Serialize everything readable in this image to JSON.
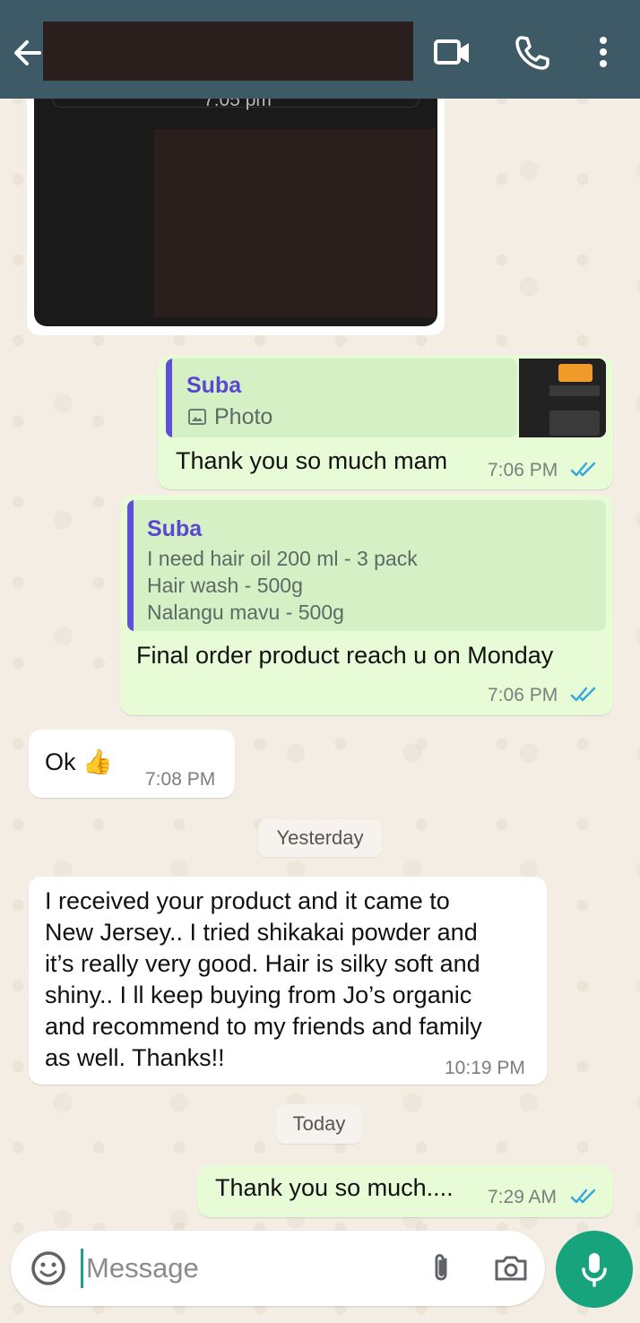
{
  "header": {
    "back_icon": "arrow-left-icon",
    "contact_name": "",
    "actions": [
      "video-camera-icon",
      "phone-icon",
      "more-vertical-icon"
    ]
  },
  "colors": {
    "header_bg": "#3d5a66",
    "outgoing_bubble": "#e7fcd6",
    "incoming_bubble": "#ffffff",
    "quote_accent": "#5d4fd6",
    "read_ticks": "#3aa6dd",
    "mic_button": "#17a37c"
  },
  "messages": {
    "image_msg": {
      "overlay_time": "7:05 pm"
    },
    "reply1": {
      "quote_author": "Suba",
      "quote_text": "Photo",
      "text": "Thank you so much mam",
      "time": "7:06 PM",
      "status": "read"
    },
    "reply2": {
      "quote_author": "Suba",
      "quote_lines": [
        "I need hair oil 200 ml - 3 pack",
        "Hair wash - 500g",
        "Nalangu mavu - 500g"
      ],
      "text": "Final order product reach u on Monday",
      "time": "7:06 PM",
      "status": "read"
    },
    "ok_msg": {
      "text": "Ok 👍",
      "time": "7:08 PM"
    },
    "yesterday_chip": "Yesterday",
    "review_msg": {
      "lines": [
        "I received your product and it came to",
        "New Jersey..  I tried shikakai powder and",
        "it’s really very good. Hair is silky soft and",
        "shiny.. I ll keep buying from Jo’s organic",
        "and recommend to my friends and family",
        "as well. Thanks!!"
      ],
      "time": "10:19 PM"
    },
    "today_chip": "Today",
    "last_msg": {
      "text": "Thank you so much....",
      "time": "7:29 AM",
      "status": "read"
    }
  },
  "composer": {
    "placeholder": "Message",
    "icons": [
      "emoji-icon",
      "paperclip-icon",
      "camera-icon",
      "microphone-icon"
    ]
  }
}
